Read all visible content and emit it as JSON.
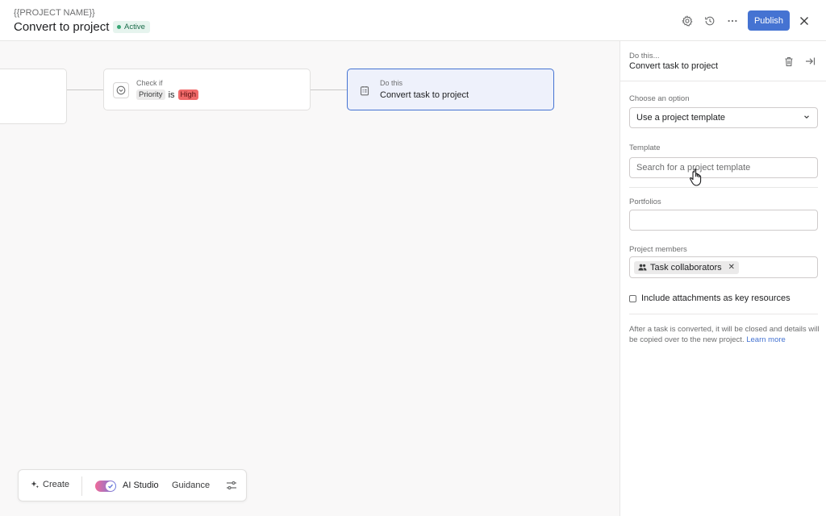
{
  "header": {
    "project_name": "{{PROJECT NAME}}",
    "title": "Convert to project",
    "status": "Active",
    "publish_label": "Publish",
    "icons": [
      "gear-icon",
      "history-icon",
      "more-icon",
      "close-icon"
    ]
  },
  "canvas": {
    "check_node": {
      "label": "Check if",
      "field": "Priority",
      "operator": "is",
      "value": "High"
    },
    "action_node": {
      "label": "Do this",
      "text": "Convert task to project"
    }
  },
  "toolbar": {
    "create_label": "Create",
    "ai_studio_label": "AI Studio",
    "guidance_label": "Guidance",
    "ai_toggle_on": true
  },
  "panel": {
    "subtitle": "Do this...",
    "title": "Convert task to project",
    "option_label": "Choose an option",
    "option_value": "Use a project template",
    "template_label": "Template",
    "template_placeholder": "Search for a project template",
    "portfolios_label": "Portfolios",
    "members_label": "Project members",
    "members_token": "Task collaborators",
    "checkbox_label": "Include attachments as key resources",
    "note": "After a task is converted, it will be closed and details will be copied over to the new project.",
    "learn_more": "Learn more"
  },
  "colors": {
    "accent": "#4573d2",
    "status_green": "#3aa776",
    "priority_red": "#f06a6a"
  }
}
